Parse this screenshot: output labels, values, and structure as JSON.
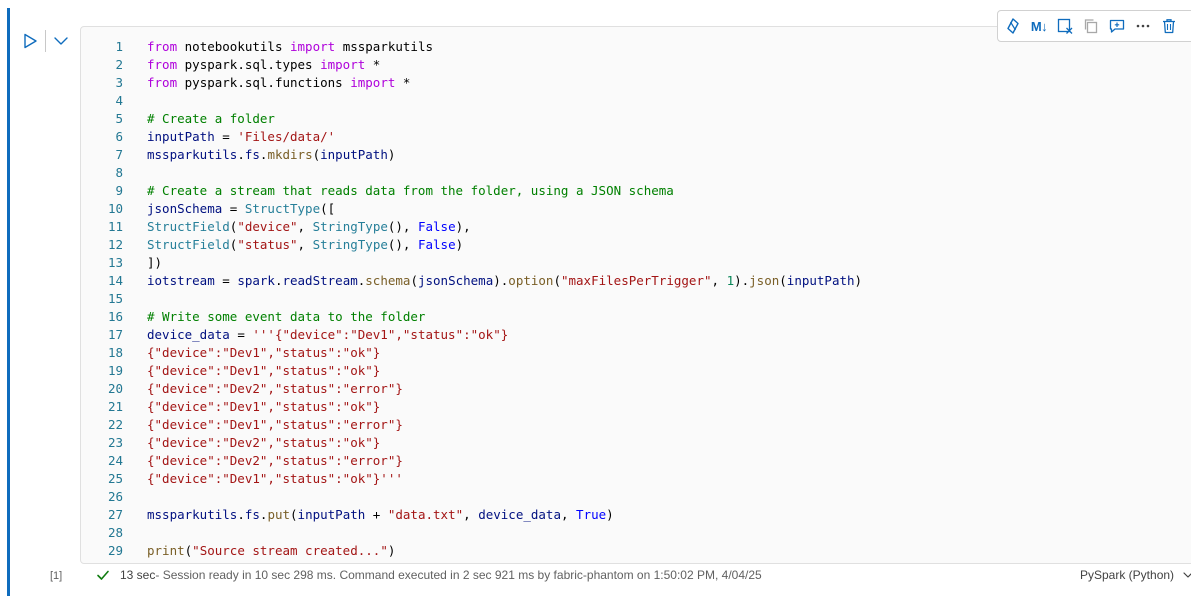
{
  "cell": {
    "execution_count": "[1]",
    "language": "PySpark (Python)",
    "status": {
      "duration": "13 sec",
      "message": " - Session ready in 10 sec 298 ms. Command executed in 2 sec 921 ms by fabric-phantom on 1:50:02 PM, 4/04/25"
    },
    "toolbar": {
      "icons": [
        "copilot-icon",
        "markdown-toggle-icon",
        "clear-output-icon",
        "copy-icon",
        "comment-icon",
        "more-icon",
        "delete-icon"
      ],
      "markdown_label": "M↓"
    }
  },
  "code_lines": [
    {
      "n": "1",
      "t": [
        [
          "from ",
          "kw"
        ],
        [
          "notebookutils ",
          ""
        ],
        [
          "import ",
          "kw"
        ],
        [
          "mssparkutils",
          ""
        ]
      ]
    },
    {
      "n": "2",
      "t": [
        [
          "from ",
          "kw"
        ],
        [
          "pyspark.sql.types ",
          ""
        ],
        [
          "import ",
          "kw"
        ],
        [
          "*",
          ""
        ]
      ]
    },
    {
      "n": "3",
      "t": [
        [
          "from ",
          "kw"
        ],
        [
          "pyspark.sql.functions ",
          ""
        ],
        [
          "import ",
          "kw"
        ],
        [
          "*",
          ""
        ]
      ]
    },
    {
      "n": "4",
      "t": []
    },
    {
      "n": "5",
      "t": [
        [
          "# Create a folder",
          "cmt"
        ]
      ]
    },
    {
      "n": "6",
      "t": [
        [
          "inputPath",
          "var"
        ],
        [
          " = ",
          ""
        ],
        [
          "'Files/data/'",
          "str"
        ]
      ]
    },
    {
      "n": "7",
      "t": [
        [
          "mssparkutils",
          "var"
        ],
        [
          ".",
          ""
        ],
        [
          "fs",
          "var"
        ],
        [
          ".",
          ""
        ],
        [
          "mkdirs",
          "fn"
        ],
        [
          "(",
          ""
        ],
        [
          "inputPath",
          "var"
        ],
        [
          ")",
          ""
        ]
      ]
    },
    {
      "n": "8",
      "t": []
    },
    {
      "n": "9",
      "t": [
        [
          "# Create a stream that reads data from the folder, using a JSON schema",
          "cmt"
        ]
      ]
    },
    {
      "n": "10",
      "t": [
        [
          "jsonSchema",
          "var"
        ],
        [
          " = ",
          ""
        ],
        [
          "StructType",
          "cls"
        ],
        [
          "([",
          ""
        ]
      ]
    },
    {
      "n": "11",
      "t": [
        [
          "StructField",
          "cls"
        ],
        [
          "(",
          ""
        ],
        [
          "\"device\"",
          "str"
        ],
        [
          ", ",
          ""
        ],
        [
          "StringType",
          "cls"
        ],
        [
          "(), ",
          ""
        ],
        [
          "False",
          "bool"
        ],
        [
          "),",
          ""
        ]
      ]
    },
    {
      "n": "12",
      "t": [
        [
          "StructField",
          "cls"
        ],
        [
          "(",
          ""
        ],
        [
          "\"status\"",
          "str"
        ],
        [
          ", ",
          ""
        ],
        [
          "StringType",
          "cls"
        ],
        [
          "(), ",
          ""
        ],
        [
          "False",
          "bool"
        ],
        [
          ")",
          ""
        ]
      ]
    },
    {
      "n": "13",
      "t": [
        [
          "])",
          ""
        ]
      ]
    },
    {
      "n": "14",
      "t": [
        [
          "iotstream",
          "var"
        ],
        [
          " = ",
          ""
        ],
        [
          "spark",
          "var"
        ],
        [
          ".",
          ""
        ],
        [
          "readStream",
          "var"
        ],
        [
          ".",
          ""
        ],
        [
          "schema",
          "fn"
        ],
        [
          "(",
          ""
        ],
        [
          "jsonSchema",
          "var"
        ],
        [
          ").",
          ""
        ],
        [
          "option",
          "fn"
        ],
        [
          "(",
          ""
        ],
        [
          "\"maxFilesPerTrigger\"",
          "str"
        ],
        [
          ", ",
          ""
        ],
        [
          "1",
          "num"
        ],
        [
          ").",
          ""
        ],
        [
          "json",
          "fn"
        ],
        [
          "(",
          ""
        ],
        [
          "inputPath",
          "var"
        ],
        [
          ")",
          ""
        ]
      ]
    },
    {
      "n": "15",
      "t": []
    },
    {
      "n": "16",
      "t": [
        [
          "# Write some event data to the folder",
          "cmt"
        ]
      ]
    },
    {
      "n": "17",
      "t": [
        [
          "device_data",
          "var"
        ],
        [
          " = ",
          ""
        ],
        [
          "'''{\"device\":\"Dev1\",\"status\":\"ok\"}",
          "str"
        ]
      ]
    },
    {
      "n": "18",
      "t": [
        [
          "{\"device\":\"Dev1\",\"status\":\"ok\"}",
          "str"
        ]
      ]
    },
    {
      "n": "19",
      "t": [
        [
          "{\"device\":\"Dev1\",\"status\":\"ok\"}",
          "str"
        ]
      ]
    },
    {
      "n": "20",
      "t": [
        [
          "{\"device\":\"Dev2\",\"status\":\"error\"}",
          "str"
        ]
      ]
    },
    {
      "n": "21",
      "t": [
        [
          "{\"device\":\"Dev1\",\"status\":\"ok\"}",
          "str"
        ]
      ]
    },
    {
      "n": "22",
      "t": [
        [
          "{\"device\":\"Dev1\",\"status\":\"error\"}",
          "str"
        ]
      ]
    },
    {
      "n": "23",
      "t": [
        [
          "{\"device\":\"Dev2\",\"status\":\"ok\"}",
          "str"
        ]
      ]
    },
    {
      "n": "24",
      "t": [
        [
          "{\"device\":\"Dev2\",\"status\":\"error\"}",
          "str"
        ]
      ]
    },
    {
      "n": "25",
      "t": [
        [
          "{\"device\":\"Dev1\",\"status\":\"ok\"}'''",
          "str"
        ]
      ]
    },
    {
      "n": "26",
      "t": []
    },
    {
      "n": "27",
      "t": [
        [
          "mssparkutils",
          "var"
        ],
        [
          ".",
          ""
        ],
        [
          "fs",
          "var"
        ],
        [
          ".",
          ""
        ],
        [
          "put",
          "fn"
        ],
        [
          "(",
          ""
        ],
        [
          "inputPath",
          "var"
        ],
        [
          " + ",
          ""
        ],
        [
          "\"data.txt\"",
          "str"
        ],
        [
          ", ",
          ""
        ],
        [
          "device_data",
          "var"
        ],
        [
          ", ",
          ""
        ],
        [
          "True",
          "bool"
        ],
        [
          ")",
          ""
        ]
      ]
    },
    {
      "n": "28",
      "t": []
    },
    {
      "n": "29",
      "t": [
        [
          "print",
          "fn"
        ],
        [
          "(",
          ""
        ],
        [
          "\"Source stream created...\"",
          "str"
        ],
        [
          ")",
          ""
        ]
      ]
    }
  ],
  "colors": {
    "accent": "#0f6cbd",
    "success": "#107c10",
    "keyword": "#af00db",
    "string": "#a31515",
    "comment": "#008000",
    "type": "#267f99",
    "function": "#795e26",
    "boolean": "#0000ff",
    "line_number": "#237893"
  }
}
